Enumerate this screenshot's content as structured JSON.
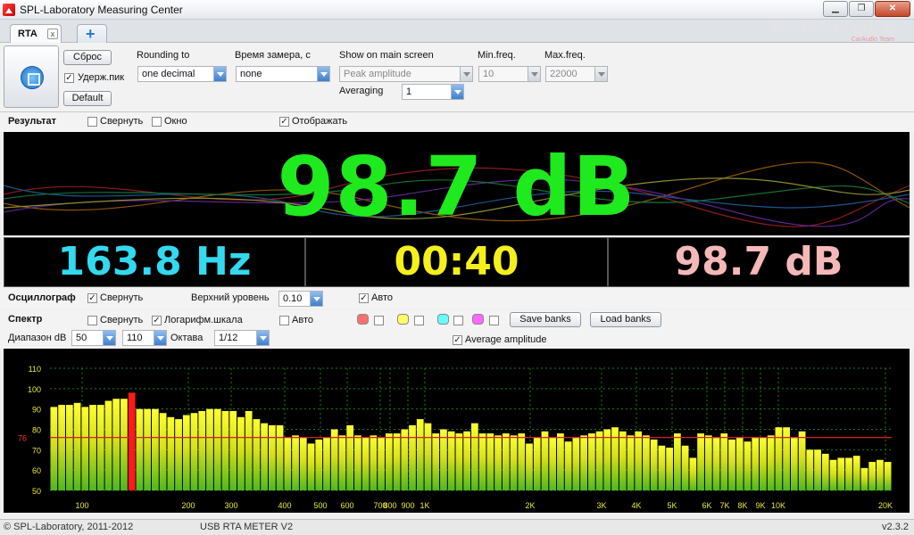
{
  "window": {
    "title": "SPL-Laboratory Measuring Center",
    "brand": "MAGNITOLA",
    "brand_sub": "CarAudio Team",
    "btn_min": "▁",
    "btn_max": "❐",
    "btn_close": "✕"
  },
  "tabs": {
    "rta_label": "RTA",
    "close_glyph": "x",
    "add_glyph": "+"
  },
  "toolbar": {
    "reset_label": "Сброс",
    "hold_peak_label": "Удерж.пик",
    "hold_peak_checked": true,
    "default_label": "Default",
    "rounding_label": "Rounding to",
    "rounding_value": "one decimal",
    "time_label": "Время замера, с",
    "time_value": "none",
    "show_label": "Show on main screen",
    "show_value": "Peak amplitude",
    "averaging_label": "Averaging",
    "averaging_value": "1",
    "minfreq_label": "Min.freq.",
    "minfreq_value": "10",
    "maxfreq_label": "Max.freq.",
    "maxfreq_value": "22000"
  },
  "result": {
    "section_label": "Результат",
    "collapse_label": "Свернуть",
    "window_label": "Окно",
    "display_label": "Отображать",
    "main_value": "98.7 dB",
    "freq_value": "163.8 Hz",
    "time_value": "00:40",
    "peak_value": "98.7 dB",
    "colors": {
      "main": "#1eea1e",
      "freq": "#33d9ee",
      "time": "#f5f01a",
      "peak": "#f5b8b8"
    }
  },
  "osc": {
    "section_label": "Осциллограф",
    "collapse_label": "Свернуть",
    "level_label": "Верхний уровень",
    "level_value": "0.10",
    "auto_label": "Авто"
  },
  "spectrum": {
    "section_label": "Спектр",
    "collapse_label": "Свернуть",
    "log_label": "Логарифм.шкала",
    "auto_label": "Авто",
    "range_label": "Диапазон dB",
    "range_min": "50",
    "range_max": "110",
    "octave_label": "Октава",
    "octave_value": "1/12",
    "save_banks_label": "Save banks",
    "load_banks_label": "Load banks",
    "avg_amplitude_label": "Average amplitude",
    "bank_colors": [
      "#ff6f6f",
      "#ffff66",
      "#66ffff",
      "#ff66ff"
    ]
  },
  "chart_data": {
    "type": "bar",
    "y_ticks": [
      110,
      100,
      90,
      80,
      70,
      60,
      50
    ],
    "ylim": [
      50,
      110
    ],
    "x_ticks": [
      "100",
      "200",
      "300",
      "400",
      "500",
      "600",
      "700",
      "800",
      "900",
      "1K",
      "2K",
      "3K",
      "4K",
      "5K",
      "6K",
      "7K",
      "8K",
      "9K",
      "10K",
      "20K"
    ],
    "reference_line": {
      "value": 76,
      "label": "76"
    },
    "peak_index": 10,
    "values": [
      91,
      92,
      92,
      93,
      91,
      92,
      92,
      94,
      95,
      95,
      98,
      90,
      90,
      90,
      88,
      86,
      85,
      87,
      88,
      89,
      90,
      90,
      89,
      89,
      86,
      89,
      85,
      83,
      82,
      82,
      76,
      77,
      76,
      73,
      75,
      76,
      80,
      77,
      82,
      77,
      76,
      77,
      76,
      78,
      78,
      80,
      82,
      85,
      83,
      78,
      80,
      79,
      78,
      79,
      83,
      78,
      78,
      77,
      78,
      77,
      78,
      73,
      76,
      79,
      76,
      78,
      74,
      76,
      77,
      78,
      79,
      80,
      81,
      79,
      77,
      79,
      77,
      75,
      72,
      71,
      78,
      72,
      66,
      78,
      77,
      76,
      78,
      75,
      76,
      74,
      76,
      76,
      77,
      81,
      81,
      76,
      79,
      70,
      70,
      68,
      65,
      66,
      66,
      67,
      61,
      64,
      65,
      64
    ]
  },
  "status": {
    "copyright": "© SPL-Laboratory, 2011-2012",
    "device": "USB RTA METER V2",
    "version": "v2.3.2"
  }
}
